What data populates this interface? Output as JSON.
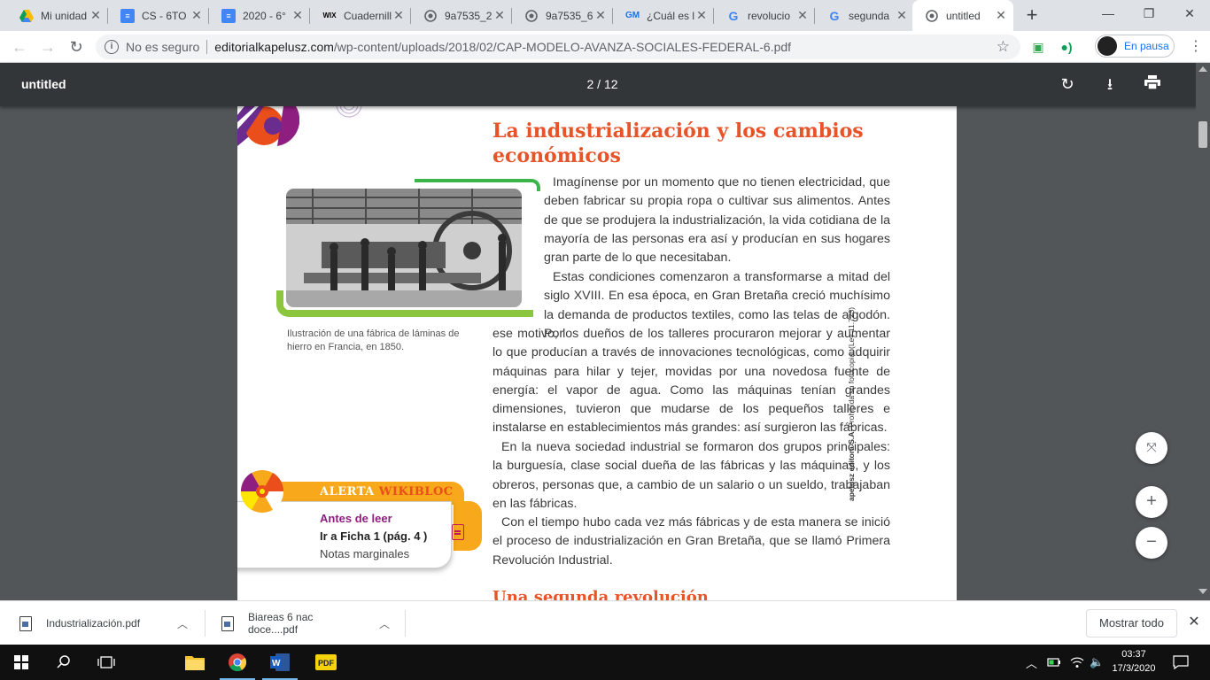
{
  "browser": {
    "tabs": [
      {
        "title": "Mi unidad",
        "icon": "drive-icon",
        "color": "#fbbc04"
      },
      {
        "title": "CS - 6TO",
        "icon": "docs-icon",
        "color": "#4285f4"
      },
      {
        "title": "2020 - 6°",
        "icon": "docs-icon",
        "color": "#4285f4"
      },
      {
        "title": "Cuadernillo",
        "icon": "wix-icon",
        "color": "#000000"
      },
      {
        "title": "9a7535_2",
        "icon": "globe-icon",
        "color": "#5f6368"
      },
      {
        "title": "9a7535_6",
        "icon": "globe-icon",
        "color": "#5f6368"
      },
      {
        "title": "¿Cuál es l",
        "icon": "gm-icon",
        "color": "#1a73e8"
      },
      {
        "title": "revolucio",
        "icon": "google-icon",
        "color": "#4285f4"
      },
      {
        "title": "segunda",
        "icon": "google-icon",
        "color": "#4285f4"
      },
      {
        "title": "untitled",
        "icon": "globe-icon",
        "color": "#5f6368",
        "active": true
      }
    ],
    "address": {
      "security_label": "No es seguro",
      "host": "editorialkapelusz.com",
      "path": "/wp-content/uploads/2018/02/CAP-MODELO-AVANZA-SOCIALES-FEDERAL-6.pdf"
    },
    "profile_label": "En pausa"
  },
  "pdf": {
    "title": "untitled",
    "page_indicator": "2 / 12"
  },
  "doc": {
    "heading_line1": "La industrialización y los cambios",
    "heading_line2": "económicos",
    "p1": "Imagínense por un momento que no tienen electricidad, que deben fabricar su propia ropa o cultivar sus alimentos. Antes de que se produjera la industrialización, la vida cotidiana de la mayoría de las personas era así y producían en sus hogares gran parte de lo que necesitaban.",
    "p2": "Estas condiciones comenzaron a transformarse a mitad del siglo XVIII. En esa época, en Gran Bretaña creció muchísimo la demanda de productos textiles, como las telas de algodón. Por",
    "p2b": "ese motivo, los dueños de los talleres procuraron mejorar y aumentar lo que producían a través de innovaciones tecnológicas, como adquirir máquinas para hilar y tejer, movidas por una novedosa fuente de energía: el vapor de agua. Como las máquinas tenían grandes dimensiones, tuvieron que mudarse de los pequeños talleres e instalarse en establecimientos más grandes: así surgieron las fábricas.",
    "p3": "En la nueva sociedad industrial se formaron dos grupos principales: la burguesía, clase social dueña de las fábricas y las máquinas, y los obreros, personas que, a cambio de un salario o un sueldo, trabajaban en las fábricas.",
    "p4": "Con el tiempo hubo cada vez más fábricas y de esta manera se inició el proceso de industrialización en Gran Bretaña, que se llamó Primera Revolución Industrial.",
    "subheading": "Una segunda revolución",
    "caption": "Ilustración de una fábrica de láminas de hierro en Francia, en 1850.",
    "side_print_bold": "apelusz editora S.A.",
    "side_print": "Prohibida su fotocopia. (Ley 11.723)",
    "alert": {
      "label_main": "ALERTA",
      "label_accent": "WIKIBLOC",
      "line1": "Antes de leer",
      "line2": "Ir a Ficha 1 (pág. 4 )",
      "line3": "Notas marginales"
    }
  },
  "downloads": {
    "items": [
      {
        "name": "Industrialización.pdf"
      },
      {
        "name": "Biareas 6 nac doce....pdf"
      }
    ],
    "show_all": "Mostrar todo"
  },
  "taskbar": {
    "time": "03:37",
    "date": "17/3/2020"
  }
}
